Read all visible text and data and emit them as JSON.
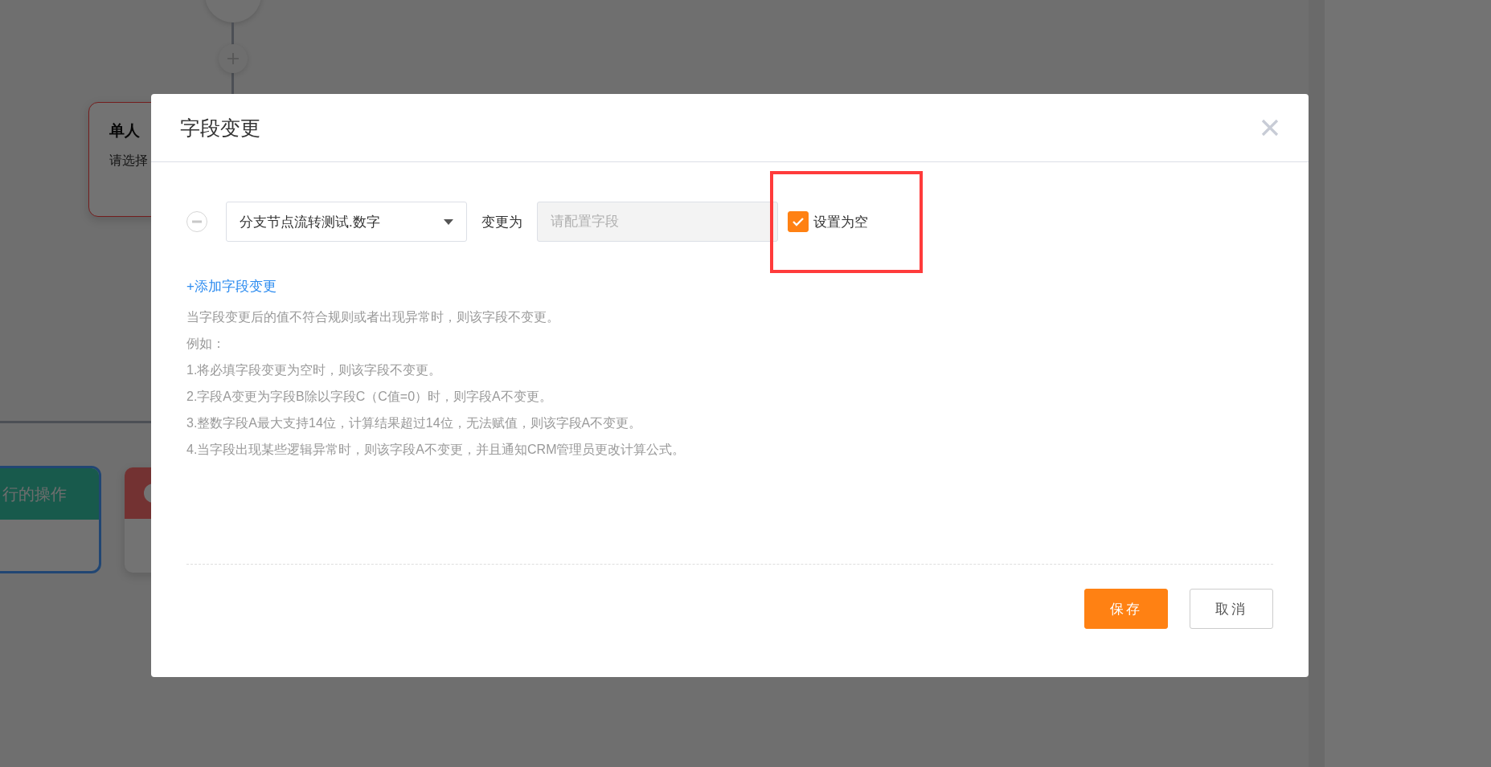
{
  "canvas": {
    "approver_card": {
      "title": "单人",
      "text": "请选择"
    },
    "action_card": {
      "title": "行的操作"
    }
  },
  "dialog": {
    "title": "字段变更",
    "rules": [
      {
        "field": "分支节点流转测试.数字",
        "label": "变更为",
        "value_placeholder": "请配置字段",
        "set_empty": {
          "label": "设置为空",
          "checked": true
        },
        "highlighted": true
      }
    ],
    "add_link": "+添加字段变更",
    "notes": [
      "当字段变更后的值不符合规则或者出现异常时，则该字段不变更。",
      "例如：",
      "1.将必填字段变更为空时，则该字段不变更。",
      "2.字段A变更为字段B除以字段C（C值=0）时，则字段A不变更。",
      "3.整数字段A最大支持14位，计算结果超过14位，无法赋值，则该字段A不变更。",
      "4.当字段出现某些逻辑异常时，则该字段A不变更，并且通知CRM管理员更改计算公式。"
    ],
    "buttons": [
      {
        "label": "保存",
        "kind": "primary"
      },
      {
        "label": "取消",
        "kind": "secondary"
      }
    ]
  }
}
